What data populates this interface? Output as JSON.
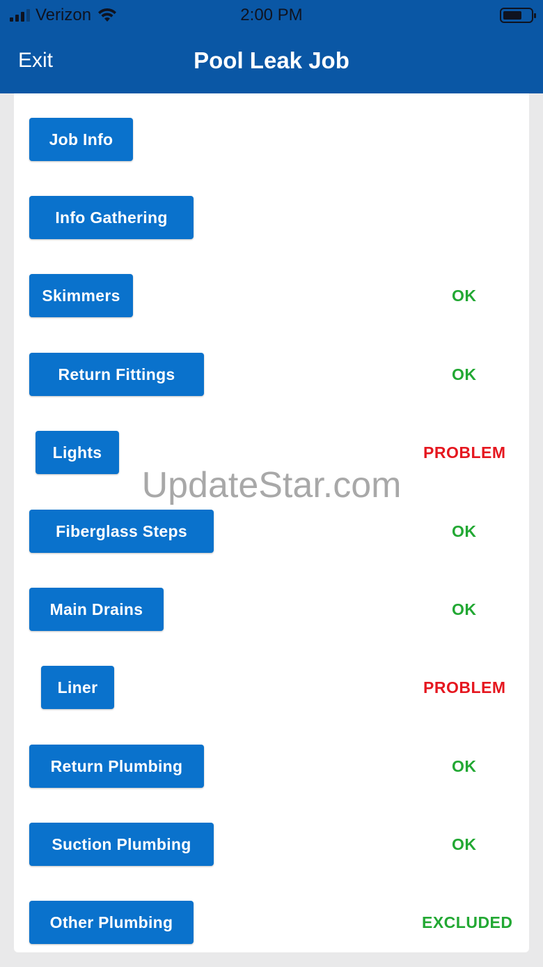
{
  "statusbar": {
    "carrier": "Verizon",
    "time": "2:00 PM"
  },
  "nav": {
    "exit_label": "Exit",
    "title": "Pool Leak Job"
  },
  "items": [
    {
      "label": "Job Info",
      "status": ""
    },
    {
      "label": "Info Gathering",
      "status": ""
    },
    {
      "label": "Skimmers",
      "status": "OK"
    },
    {
      "label": "Return Fittings",
      "status": "OK"
    },
    {
      "label": "Lights",
      "status": "PROBLEM"
    },
    {
      "label": "Fiberglass Steps",
      "status": "OK"
    },
    {
      "label": "Main Drains",
      "status": "OK"
    },
    {
      "label": "Liner",
      "status": "PROBLEM"
    },
    {
      "label": "Return Plumbing",
      "status": "OK"
    },
    {
      "label": "Suction Plumbing",
      "status": "OK"
    },
    {
      "label": "Other Plumbing",
      "status": "EXCLUDED"
    }
  ],
  "watermark": "UpdateStar.com",
  "colors": {
    "header": "#0a57a5",
    "button": "#0a72cc",
    "ok": "#22a833",
    "problem": "#e5171f"
  }
}
